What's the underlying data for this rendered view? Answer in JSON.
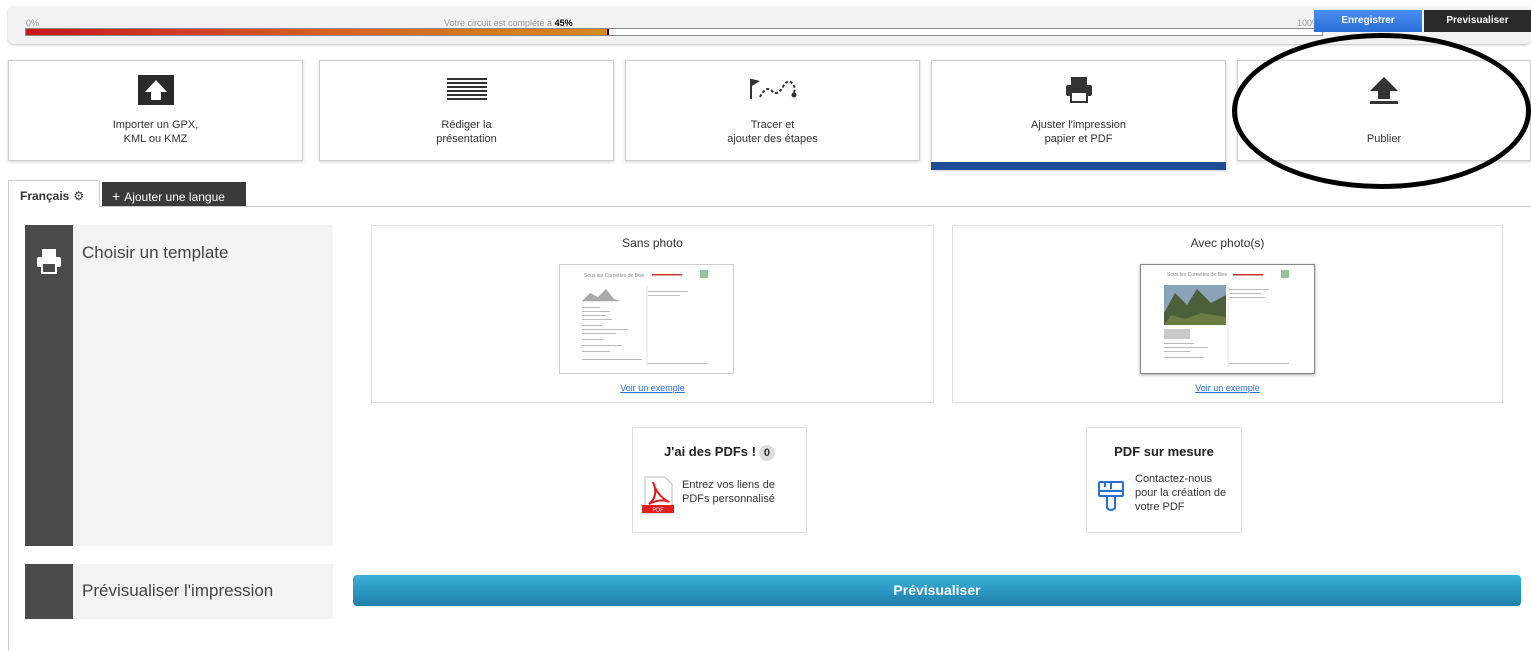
{
  "progress": {
    "start_label": "0%",
    "end_label": "100%",
    "message_prefix": "Votre circuit est complété à ",
    "percent_label": "45%",
    "percent_value": 45,
    "save_label": "Enregistrer",
    "preview_label": "Previsualiser"
  },
  "steps": [
    {
      "label": "Importer un GPX,\nKML ou KMZ",
      "icon": "upload-box-icon"
    },
    {
      "label": "Rédiger la\nprésentation",
      "icon": "text-lines-icon"
    },
    {
      "label": "Tracer et\najouter des étapes",
      "icon": "route-flag-icon"
    },
    {
      "label": "Ajuster l'impression\npapier et PDF",
      "icon": "printer-icon",
      "active": true
    },
    {
      "label": "Publier",
      "icon": "upload-arrow-icon"
    }
  ],
  "tabs": {
    "current_language": "Français",
    "add_language": "Ajouter une langue"
  },
  "sections": {
    "template_title": "Choisir un template",
    "preview_title": "Prévisualiser l'impression"
  },
  "templates": [
    {
      "title": "Sans photo",
      "link": "Voir un exemple",
      "thumb_heading": "Sous les Cornettes de Bise"
    },
    {
      "title": "Avec photo(s)",
      "link": "Voir un exemple",
      "thumb_heading": "Sous les Cornettes de Bise"
    }
  ],
  "pdf_options": {
    "own": {
      "title": "J'ai des PDFs !",
      "count": "0",
      "text": "Entrez vos liens de\nPDFs personnalisé",
      "icon_label": "PDF"
    },
    "custom": {
      "title": "PDF sur mesure",
      "text": "Contactez-nous\npour la création de\nvotre PDF"
    }
  },
  "preview_button": "Prévisualiser",
  "colors": {
    "active_step": "#1f4e96",
    "save_button": "#2a6fd6",
    "preview_button": "#2a98c2",
    "sidebar_dark": "#4a4a4a"
  }
}
